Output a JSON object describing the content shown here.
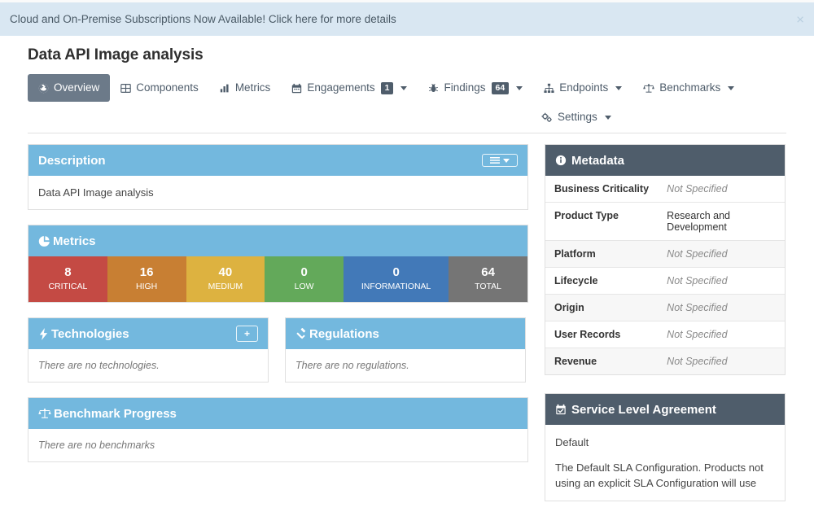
{
  "banner": {
    "text": "Cloud and On-Premise Subscriptions Now Available! Click here for more details",
    "close_label": "×"
  },
  "header": {
    "title": "Data API Image analysis"
  },
  "tabs": [
    {
      "label": "Overview",
      "icon": "globe-icon",
      "active": true,
      "badge": null,
      "caret": false
    },
    {
      "label": "Components",
      "icon": "table-icon",
      "active": false,
      "badge": null,
      "caret": false
    },
    {
      "label": "Metrics",
      "icon": "bar-chart-icon",
      "active": false,
      "badge": null,
      "caret": false
    },
    {
      "label": "Engagements",
      "icon": "calendar-icon",
      "active": false,
      "badge": "1",
      "caret": true
    },
    {
      "label": "Findings",
      "icon": "bug-icon",
      "active": false,
      "badge": "64",
      "caret": true
    },
    {
      "label": "Endpoints",
      "icon": "sitemap-icon",
      "active": false,
      "badge": null,
      "caret": true
    },
    {
      "label": "Benchmarks",
      "icon": "balance-scale-icon",
      "active": false,
      "badge": null,
      "caret": true
    },
    {
      "label": "Settings",
      "icon": "cogs-icon",
      "active": false,
      "badge": null,
      "caret": true
    }
  ],
  "description": {
    "title": "Description",
    "menu_label": "menu",
    "body": "Data API Image analysis"
  },
  "metrics": {
    "title": "Metrics",
    "severities": [
      {
        "label": "CRITICAL",
        "count": "8",
        "color": "#c44a44"
      },
      {
        "label": "HIGH",
        "count": "16",
        "color": "#c87f33"
      },
      {
        "label": "MEDIUM",
        "count": "40",
        "color": "#ddb240"
      },
      {
        "label": "LOW",
        "count": "0",
        "color": "#63a95a"
      },
      {
        "label": "INFORMATIONAL",
        "count": "0",
        "color": "#4279b8"
      },
      {
        "label": "TOTAL",
        "count": "64",
        "color": "#757575"
      }
    ]
  },
  "technologies": {
    "title": "Technologies",
    "add_label": "+",
    "empty": "There are no technologies."
  },
  "regulations": {
    "title": "Regulations",
    "empty": "There are no regulations."
  },
  "benchmark_progress": {
    "title": "Benchmark Progress",
    "empty": "There are no benchmarks"
  },
  "metadata": {
    "title": "Metadata",
    "rows": [
      {
        "key": "Business Criticality",
        "value": "Not Specified",
        "unset": true
      },
      {
        "key": "Product Type",
        "value": "Research and Development",
        "unset": false
      },
      {
        "key": "Platform",
        "value": "Not Specified",
        "unset": true
      },
      {
        "key": "Lifecycle",
        "value": "Not Specified",
        "unset": true
      },
      {
        "key": "Origin",
        "value": "Not Specified",
        "unset": true
      },
      {
        "key": "User Records",
        "value": "Not Specified",
        "unset": true
      },
      {
        "key": "Revenue",
        "value": "Not Specified",
        "unset": true
      }
    ]
  },
  "sla": {
    "title": "Service Level Agreement",
    "name": "Default",
    "description": "The Default SLA Configuration. Products not using an explicit SLA Configuration will use"
  },
  "colors": {
    "panel_header_blue": "#73b8de",
    "panel_header_dark": "#4f5d6b",
    "active_tab": "#6c7a89",
    "banner_bg": "#d9e7f2"
  }
}
